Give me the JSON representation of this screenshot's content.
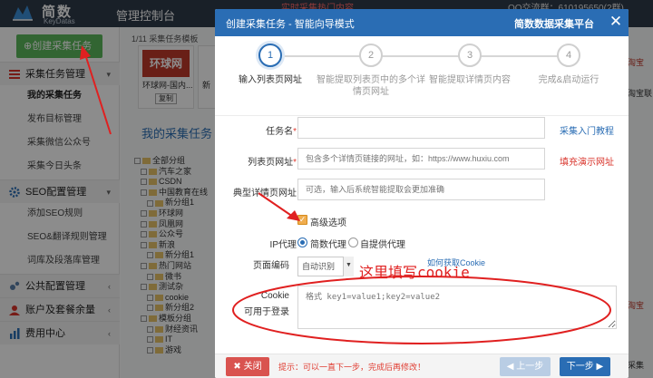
{
  "app": {
    "logo_cn": "简数",
    "logo_en": "KeyDatas",
    "console_title": "管理控制台",
    "notice": "…实时采集热门内容…",
    "qq": "QQ交流群：610195650(2群)"
  },
  "sidebar": {
    "create_label": "创建采集任务",
    "groups": [
      {
        "label": "采集任务管理",
        "items": [
          "我的采集任务",
          "发布目标管理",
          "采集微信公众号",
          "采集今日头条"
        ]
      },
      {
        "label": "SEO配置管理",
        "items": [
          "添加SEO规则",
          "SEO&翻译规则管理",
          "词库及段落库管理"
        ]
      },
      {
        "label": "公共配置管理",
        "items": []
      },
      {
        "label": "账户及套餐余量",
        "items": []
      },
      {
        "label": "费用中心",
        "items": []
      }
    ]
  },
  "main": {
    "tpl_count": "1/11 采集任务模板",
    "templates": [
      {
        "logo": "环球网",
        "name": "环球网-国内..."
      },
      {
        "logo": "新",
        "name": "新"
      }
    ],
    "copy_label": "复制",
    "my_tasks_title": "我的采集任务",
    "tree": [
      "全部分组",
      "汽车之家",
      "CSDN",
      "中国教育在线",
      "新分组1",
      "环球网",
      "凤凰网",
      "公众号",
      "新浪",
      "新分组1",
      "热门网站",
      "微书",
      "测试杂",
      "cookie",
      "新分组2",
      "模板分组",
      "财经资讯",
      "IT",
      "游戏"
    ],
    "right_edge": [
      "淘宝",
      "淘宝联",
      "淘宝",
      "采集"
    ]
  },
  "modal": {
    "title": "创建采集任务 - 智能向导模式",
    "brand": "简数数据采集平台",
    "close_glyph": "✕",
    "steps": [
      {
        "num": "1",
        "label": "输入列表页网址",
        "active": true
      },
      {
        "num": "2",
        "label": "智能提取列表页中的多个详情页网址",
        "active": false
      },
      {
        "num": "3",
        "label": "智能提取详情页内容",
        "active": false
      },
      {
        "num": "4",
        "label": "完成&启动运行",
        "active": false
      }
    ],
    "form": {
      "task_name_label": "任务名",
      "task_name_link": "采集入门教程",
      "list_url_label": "列表页网址",
      "list_url_placeholder": "包含多个详情页链接的网址，如：https://www.huxiu.com",
      "list_url_link": "填充演示网址",
      "detail_url_label": "典型详情页网址",
      "detail_url_placeholder": "可选，输入后系统智能提取会更加准确",
      "advanced_label": "高级选项",
      "ip_proxy_label": "IP代理",
      "ip_option_1": "简数代理",
      "ip_option_2": "自提供代理",
      "encoding_label": "页面编码",
      "encoding_value": "自动识别",
      "cookie_link": "如何获取Cookie",
      "cookie_label": "Cookie",
      "cookie_sub_label": "可用于登录",
      "cookie_placeholder": "格式 key1=value1;key2=value2"
    },
    "footer": {
      "close_label": "关闭",
      "tip": "提示：可以一直下一步，完成后再修改！",
      "prev_label": "上一步",
      "next_label": "下一步"
    }
  },
  "annotation": {
    "text": "这里填写cookie",
    "color": "#e02020"
  },
  "colors": {
    "primary": "#2a6db4",
    "danger": "#d9534f",
    "success": "#5cb85c",
    "warning": "#f0ad4e"
  }
}
